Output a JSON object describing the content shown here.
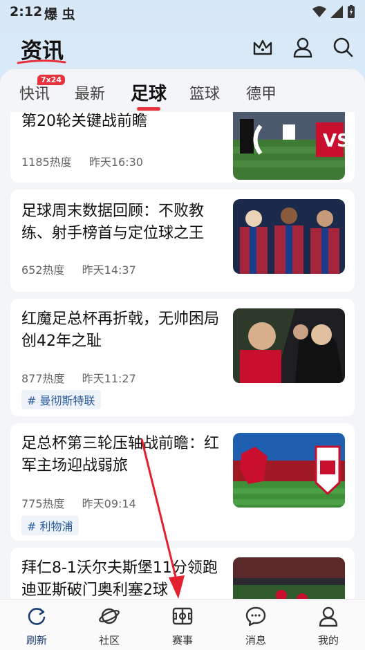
{
  "status": {
    "time": "2:12",
    "app_icons": "爆 虫"
  },
  "header": {
    "title": "资讯"
  },
  "tabs": [
    {
      "label": "快讯",
      "badge": "7x24"
    },
    {
      "label": "最新"
    },
    {
      "label": "足球"
    },
    {
      "label": "篮球"
    },
    {
      "label": "德甲"
    }
  ],
  "articles": [
    {
      "title": "第20轮关键战前瞻",
      "heat": "1185热度",
      "time": "昨天16:30"
    },
    {
      "title": "足球周末数据回顾：不败教练、射手榜首与定位球之王",
      "heat": "652热度",
      "time": "昨天14:37"
    },
    {
      "title": "红魔足总杯再折戟，无帅困局创42年之耻",
      "heat": "877热度",
      "time": "昨天11:27",
      "tag": "# 曼彻斯特联"
    },
    {
      "title": "足总杯第三轮压轴战前瞻：红军主场迎战弱旅",
      "heat": "775热度",
      "time": "昨天09:14",
      "tag": "# 利物浦"
    },
    {
      "title": "拜仁8-1沃尔夫斯堡11分领跑 迪亚斯破门奥利塞2球"
    }
  ],
  "bottom_nav": [
    {
      "label": "刷新",
      "icon": "refresh-icon"
    },
    {
      "label": "社区",
      "icon": "planet-icon"
    },
    {
      "label": "赛事",
      "icon": "pitch-icon"
    },
    {
      "label": "消息",
      "icon": "chat-bubble-icon"
    },
    {
      "label": "我的",
      "icon": "person-icon"
    }
  ],
  "colors": {
    "accent": "#e8333d",
    "active_nav": "#1c3f73"
  }
}
